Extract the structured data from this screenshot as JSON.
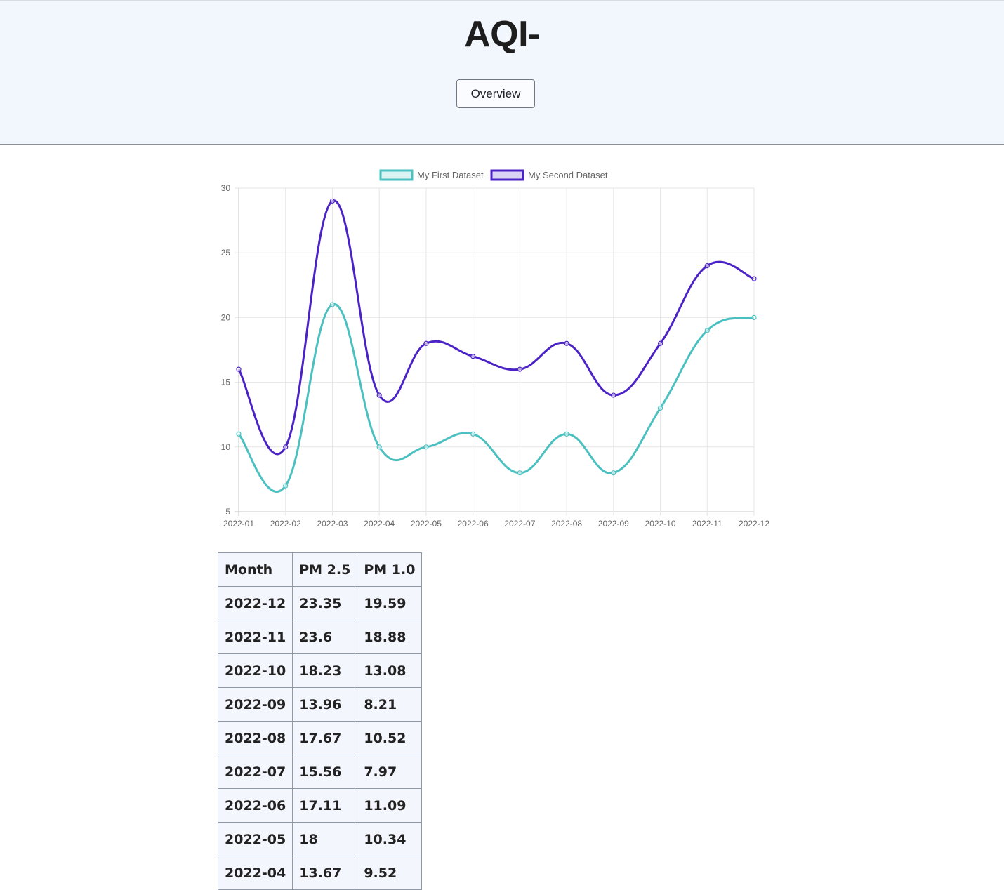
{
  "header": {
    "title": "AQI-",
    "overview_label": "Overview"
  },
  "colors": {
    "header_bg": "#f2f6fd",
    "series_1": "#4bc0c0",
    "series_2": "#4b22c6"
  },
  "chart_data": {
    "type": "line",
    "categories": [
      "2022-01",
      "2022-02",
      "2022-03",
      "2022-04",
      "2022-05",
      "2022-06",
      "2022-07",
      "2022-08",
      "2022-09",
      "2022-10",
      "2022-11",
      "2022-12"
    ],
    "series": [
      {
        "name": "My First Dataset",
        "color": "#4bc0c0",
        "values": [
          11,
          7,
          21,
          10,
          10,
          11,
          8,
          11,
          8,
          13,
          19,
          20
        ]
      },
      {
        "name": "My Second Dataset",
        "color": "#4b22c6",
        "values": [
          16,
          10,
          29,
          14,
          18,
          17,
          16,
          18,
          14,
          18,
          24,
          23
        ]
      }
    ],
    "ylim": [
      5,
      30
    ],
    "yticks": [
      5,
      10,
      15,
      20,
      25,
      30
    ],
    "grid": true,
    "legend": "top-center",
    "smooth": true
  },
  "table": {
    "headers": [
      "Month",
      "PM 2.5",
      "PM 1.0"
    ],
    "rows": [
      [
        "2022-12",
        "23.35",
        "19.59"
      ],
      [
        "2022-11",
        "23.6",
        "18.88"
      ],
      [
        "2022-10",
        "18.23",
        "13.08"
      ],
      [
        "2022-09",
        "13.96",
        "8.21"
      ],
      [
        "2022-08",
        "17.67",
        "10.52"
      ],
      [
        "2022-07",
        "15.56",
        "7.97"
      ],
      [
        "2022-06",
        "17.11",
        "11.09"
      ],
      [
        "2022-05",
        "18",
        "10.34"
      ],
      [
        "2022-04",
        "13.67",
        "9.52"
      ]
    ]
  }
}
